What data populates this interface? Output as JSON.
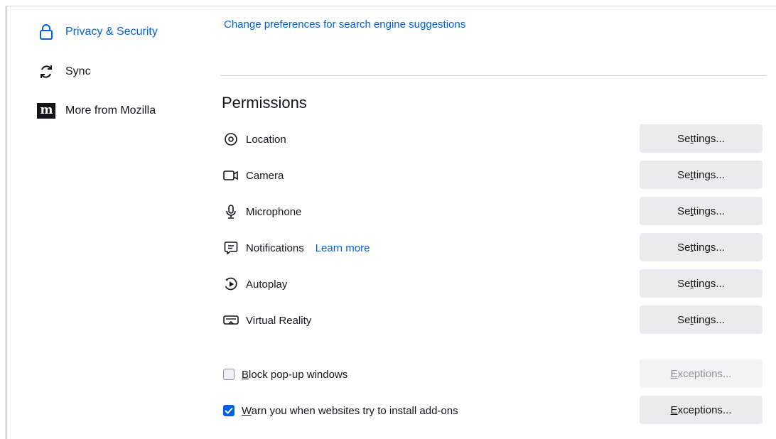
{
  "sidebar": {
    "items": [
      {
        "label": "Privacy & Security",
        "icon": "lock-icon",
        "active": true
      },
      {
        "label": "Sync",
        "icon": "sync-icon"
      },
      {
        "label": "More from Mozilla",
        "icon": "mozilla-icon",
        "logo_text": "m"
      }
    ]
  },
  "main": {
    "search_suggestions_link": "Change preferences for search engine suggestions",
    "permissions": {
      "title": "Permissions",
      "rows": [
        {
          "label": "Location",
          "icon": "location-icon",
          "button": {
            "pre": "Se",
            "u": "t",
            "post": "tings..."
          }
        },
        {
          "label": "Camera",
          "icon": "camera-icon",
          "button": {
            "pre": "Se",
            "u": "t",
            "post": "tings..."
          }
        },
        {
          "label": "Microphone",
          "icon": "microphone-icon",
          "button": {
            "pre": "Se",
            "u": "t",
            "post": "tings..."
          }
        },
        {
          "label": "Notifications",
          "icon": "notifications-icon",
          "learn_more": "Learn more",
          "button": {
            "pre": "Se",
            "u": "t",
            "post": "tings..."
          }
        },
        {
          "label": "Autoplay",
          "icon": "autoplay-icon",
          "button": {
            "pre": "Se",
            "u": "t",
            "post": "tings..."
          }
        },
        {
          "label": "Virtual Reality",
          "icon": "vr-headset-icon",
          "button": {
            "pre": "Se",
            "u": "t",
            "post": "tings..."
          }
        }
      ]
    },
    "checkboxes": [
      {
        "u": "B",
        "post": "lock pop-up windows",
        "checked": false,
        "button": {
          "u": "E",
          "post": "xceptions...",
          "disabled": true
        }
      },
      {
        "u": "W",
        "post": "arn you when websites try to install add-ons",
        "checked": true,
        "button": {
          "u": "E",
          "post": "xceptions...",
          "disabled": false
        }
      }
    ]
  },
  "colors": {
    "accent": "#0061e0",
    "button_bg": "#ebebef",
    "text": "#15141a",
    "divider": "#d7d7db"
  }
}
